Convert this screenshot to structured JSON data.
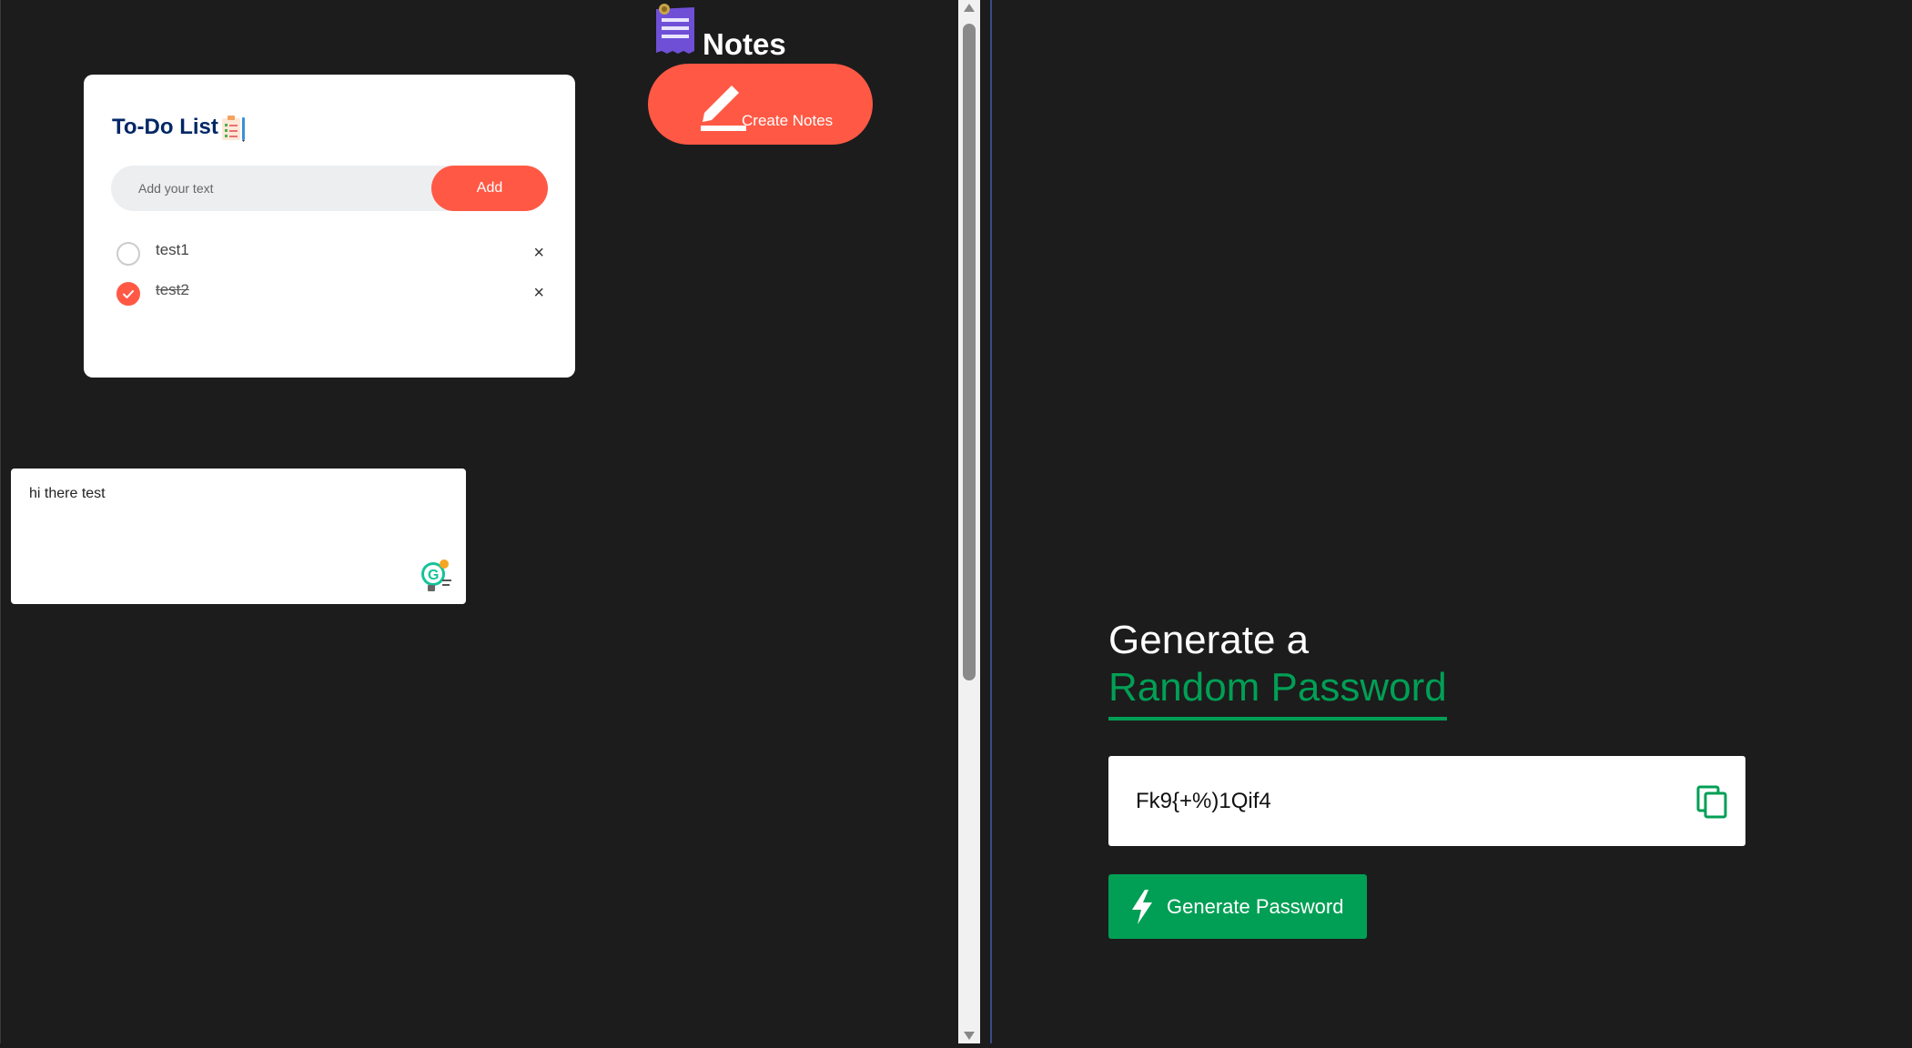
{
  "todo": {
    "title": "To-Do List",
    "input_placeholder": "Add your text",
    "add_label": "Add",
    "tasks": [
      {
        "label": "test1",
        "checked": false,
        "remove": "×"
      },
      {
        "label": "test2",
        "checked": true,
        "remove": "×"
      }
    ]
  },
  "notes": {
    "title": "Notes",
    "create_label": "Create Notes",
    "note_text": "hi there test"
  },
  "password": {
    "heading_line1": "Generate a",
    "heading_line2": "Random Password",
    "value": "Fk9{+%)1Qif4",
    "generate_label": "Generate Password"
  },
  "colors": {
    "accent_red": "#ff5945",
    "accent_green": "#019f55",
    "todo_title": "#002765",
    "background": "#1c1c1c"
  },
  "icons": [
    "checklist-icon",
    "notes-icon",
    "pencil-icon",
    "check-icon",
    "close-icon",
    "grammarly-icon",
    "copy-icon",
    "bolt-icon"
  ]
}
